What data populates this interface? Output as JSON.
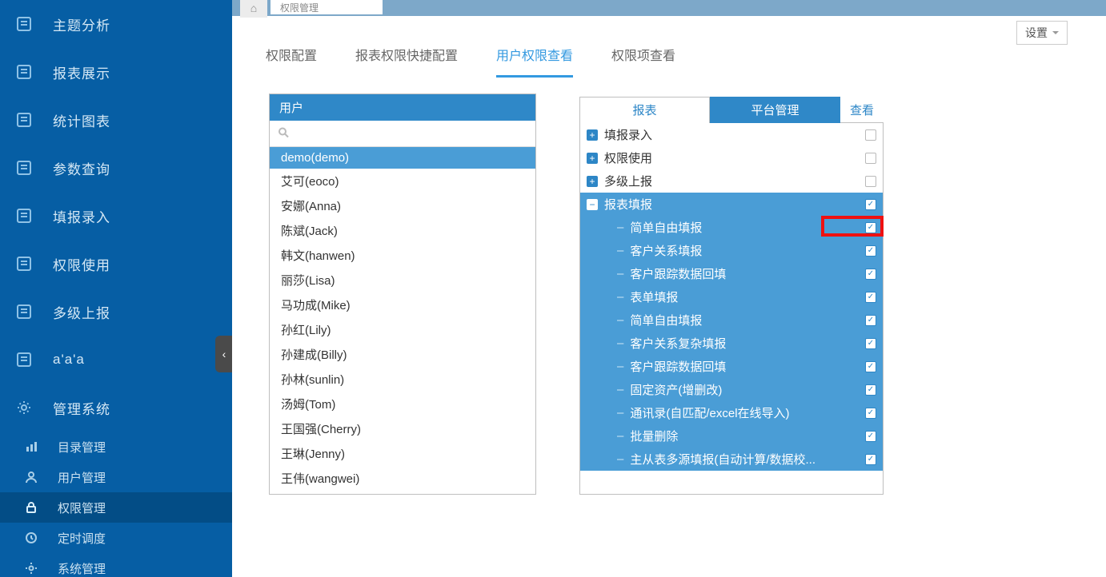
{
  "topbar": {
    "tab_label": "权限管理"
  },
  "settings_label": "设置",
  "sidebar": {
    "items": [
      {
        "label": "主题分析"
      },
      {
        "label": "报表展示"
      },
      {
        "label": "统计图表"
      },
      {
        "label": "参数查询"
      },
      {
        "label": "填报录入"
      },
      {
        "label": "权限使用"
      },
      {
        "label": "多级上报"
      },
      {
        "label": "a'a'a"
      },
      {
        "label": "管理系统"
      }
    ],
    "subitems": [
      {
        "label": "目录管理",
        "active": false
      },
      {
        "label": "用户管理",
        "active": false
      },
      {
        "label": "权限管理",
        "active": true
      },
      {
        "label": "定时调度",
        "active": false
      },
      {
        "label": "系统管理",
        "active": false
      }
    ]
  },
  "tabs": [
    {
      "label": "权限配置",
      "active": false
    },
    {
      "label": "报表权限快捷配置",
      "active": false
    },
    {
      "label": "用户权限查看",
      "active": true
    },
    {
      "label": "权限项查看",
      "active": false
    }
  ],
  "user_panel": {
    "title": "用户",
    "search_placeholder": "",
    "users": [
      {
        "label": "demo(demo)",
        "active": true
      },
      {
        "label": "艾可(eoco)"
      },
      {
        "label": "安娜(Anna)"
      },
      {
        "label": "陈斌(Jack)"
      },
      {
        "label": "韩文(hanwen)"
      },
      {
        "label": "丽莎(Lisa)"
      },
      {
        "label": "马功成(Mike)"
      },
      {
        "label": "孙红(Lily)"
      },
      {
        "label": "孙建成(Billy)"
      },
      {
        "label": "孙林(sunlin)"
      },
      {
        "label": "汤姆(Tom)"
      },
      {
        "label": "王国强(Cherry)"
      },
      {
        "label": "王琳(Jenny)"
      },
      {
        "label": "王伟(wangwei)"
      }
    ]
  },
  "perm_panel": {
    "tab_report": "报表",
    "tab_platform": "平台管理",
    "view_link": "查看",
    "top_items": [
      {
        "label": "填报录入",
        "checked": false
      },
      {
        "label": "权限使用",
        "checked": false
      },
      {
        "label": "多级上报",
        "checked": false
      }
    ],
    "group_title": "报表填报",
    "group_checked": true,
    "children": [
      {
        "label": "简单自由填报",
        "checked": true,
        "highlight": true
      },
      {
        "label": "客户关系填报",
        "checked": true
      },
      {
        "label": "客户跟踪数据回填",
        "checked": true
      },
      {
        "label": "表单填报",
        "checked": true
      },
      {
        "label": "简单自由填报",
        "checked": true
      },
      {
        "label": "客户关系复杂填报",
        "checked": true
      },
      {
        "label": "客户跟踪数据回填",
        "checked": true
      },
      {
        "label": "固定资产(增删改)",
        "checked": true
      },
      {
        "label": "通讯录(自匹配/excel在线导入)",
        "checked": true
      },
      {
        "label": "批量删除",
        "checked": true
      },
      {
        "label": "主从表多源填报(自动计算/数据校...",
        "checked": true
      }
    ]
  }
}
